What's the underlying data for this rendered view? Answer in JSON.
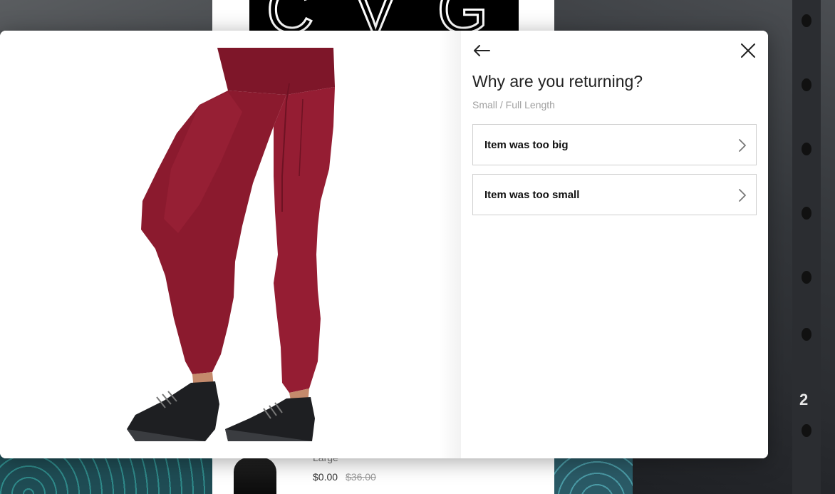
{
  "background": {
    "logo_text": "CVG",
    "rack_number": "2",
    "product_row": {
      "size": "Large",
      "price": "$0.00",
      "compare_price": "$36.00"
    }
  },
  "modal": {
    "product_image": "burgundy-full-length-leggings",
    "title": "Why are you returning?",
    "subtitle": "Small / Full Length",
    "back_icon": "arrow-left-icon",
    "close_icon": "close-icon",
    "reasons": [
      {
        "label": "Item was too big",
        "icon": "chevron-right-icon"
      },
      {
        "label": "Item was too small",
        "icon": "chevron-right-icon"
      }
    ]
  },
  "colors": {
    "leggings": "#8b1a2e",
    "shoes": "#1e1f22",
    "option_border": "#cfcfcf",
    "subtitle": "#a0a0a0"
  }
}
